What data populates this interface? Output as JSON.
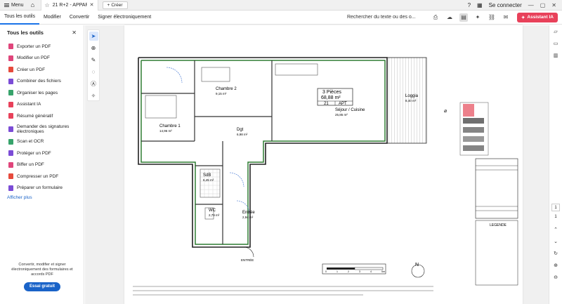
{
  "tabbar": {
    "menu_label": "Menu",
    "doc_tab_title": "21 R+2 - APPARTE...",
    "new_tab_label": "Créer",
    "login_label": "Se connecter"
  },
  "toolbar": {
    "menu_items": [
      "Tous les outils",
      "Modifier",
      "Convertir",
      "Signer électroniquement"
    ],
    "search_placeholder": "Rechercher du texte ou des o...",
    "ai_button": "Assistant IA"
  },
  "left_panel": {
    "title": "Tous les outils",
    "tools": [
      {
        "label": "Exporter un PDF",
        "color": "#e0457b"
      },
      {
        "label": "Modifier un PDF",
        "color": "#e0457b"
      },
      {
        "label": "Créer un PDF",
        "color": "#e64a3c"
      },
      {
        "label": "Combiner des fichiers",
        "color": "#7b4cd6"
      },
      {
        "label": "Organiser les pages",
        "color": "#37a36b"
      },
      {
        "label": "Assistant IA",
        "color": "#e8415a"
      },
      {
        "label": "Résumé génératif",
        "color": "#e8415a"
      },
      {
        "label": "Demander des signatures électroniques",
        "color": "#7b4cd6"
      },
      {
        "label": "Scan et OCR",
        "color": "#37a36b"
      },
      {
        "label": "Protéger un PDF",
        "color": "#7b4cd6"
      },
      {
        "label": "Biffer un PDF",
        "color": "#e0457b"
      },
      {
        "label": "Compresser un PDF",
        "color": "#e64a3c"
      },
      {
        "label": "Préparer un formulaire",
        "color": "#7b4cd6"
      }
    ],
    "more_link": "Afficher plus",
    "promo_text": "Convertir, modifier et signer électroniquement des formulaires et accords PDF",
    "promo_button": "Essai gratuit"
  },
  "plan": {
    "rooms": [
      {
        "name": "Chambre 2",
        "area": "9,15 m²"
      },
      {
        "name": "Chambre 1",
        "area": "14,96 m²"
      },
      {
        "name": "Dgt",
        "area": "6,98 m²"
      },
      {
        "name": "SdB",
        "area": "6,45 m²"
      },
      {
        "name": "WC",
        "area": "2,79 m²"
      },
      {
        "name": "Entrée",
        "area": "2,94 m²"
      },
      {
        "name": "Loggia",
        "area": "8,40 m²"
      },
      {
        "name": "Séjour / Cuisine",
        "area": "25,85 m²"
      }
    ],
    "apartment_box": {
      "type": "3 Pièces",
      "area": "68,88 m²",
      "number": "21",
      "kind": "APT"
    },
    "entry_label": "ENTRÉE",
    "legend_title": "LEGENDE",
    "scale_labels": [
      "0",
      "1",
      "2",
      "3",
      "4",
      "5m"
    ]
  },
  "right_rail": {
    "current_page": "1",
    "total_pages": "1"
  },
  "colors": {
    "accent": "#1a63c8",
    "ai": "#e8415a",
    "plan_green": "#2e7d32"
  }
}
